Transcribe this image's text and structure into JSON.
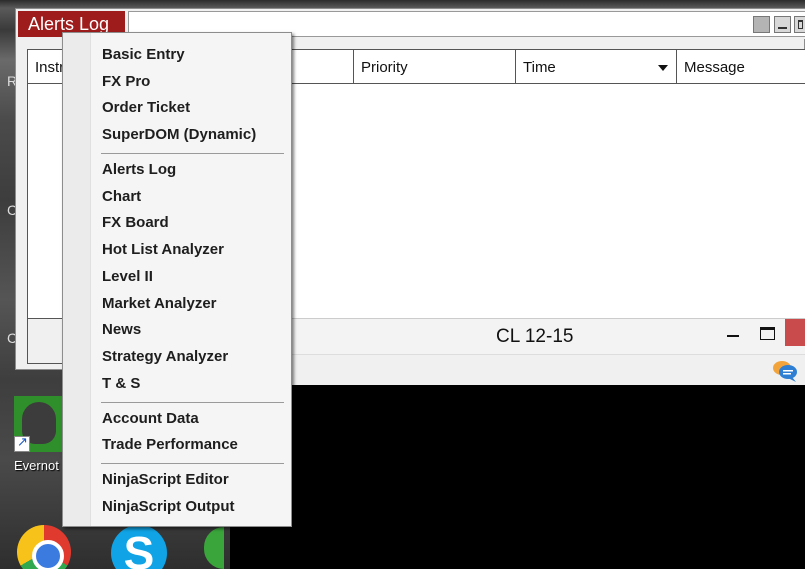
{
  "alerts_window": {
    "title": "Alerts Log",
    "columns": [
      "Instr",
      "Priority",
      "Time",
      "Message"
    ]
  },
  "chart_window": {
    "title": "CL 12-15"
  },
  "desktop": {
    "evernote_label": "Evernot",
    "side_letters": [
      "R",
      "C",
      "C"
    ]
  },
  "context_menu": {
    "group1": [
      "Basic Entry",
      "FX Pro",
      "Order Ticket",
      "SuperDOM (Dynamic)"
    ],
    "group2": [
      "Alerts Log",
      "Chart",
      "FX Board",
      "Hot List Analyzer",
      "Level II",
      "Market Analyzer",
      "News",
      "Strategy Analyzer",
      "T & S"
    ],
    "group3": [
      "Account Data",
      "Trade Performance"
    ],
    "group4": [
      "NinjaScript Editor",
      "NinjaScript Output"
    ]
  },
  "colors": {
    "title_accent": "#9e1c1c",
    "close_red": "#c94b4b"
  }
}
